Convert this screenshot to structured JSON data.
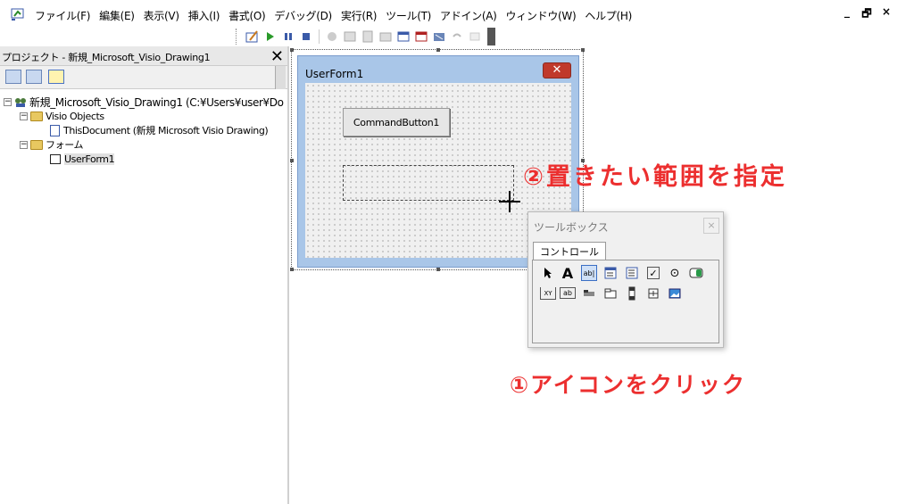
{
  "menubar": {
    "items": [
      "ファイル(F)",
      "編集(E)",
      "表示(V)",
      "挿入(I)",
      "書式(O)",
      "デバッグ(D)",
      "実行(R)",
      "ツール(T)",
      "アドイン(A)",
      "ウィンドウ(W)",
      "ヘルプ(H)"
    ],
    "window_controls": [
      "_",
      "🗗",
      "×"
    ]
  },
  "project": {
    "title": "プロジェクト - 新規_Microsoft_Visio_Drawing1",
    "close": "✕",
    "tree": {
      "root": "新規_Microsoft_Visio_Drawing1 (C:¥Users¥user¥Do",
      "visio_objects": "Visio Objects",
      "this_document": "ThisDocument (新規 Microsoft Visio Drawing)",
      "forms": "フォーム",
      "userform": "UserForm1"
    }
  },
  "form": {
    "title": "UserForm1",
    "close": "✕",
    "command_button": "CommandButton1"
  },
  "toolbox": {
    "title": "ツールボックス",
    "close": "×",
    "tab": "コントロール",
    "row1": [
      "pointer",
      "label",
      "textbox",
      "combobox",
      "listbox",
      "checkbox",
      "optionbutton",
      "togglebutton"
    ],
    "row2": [
      "frame",
      "commandbutton",
      "tabstrip",
      "multipage",
      "scrollbar",
      "spinbutton",
      "image"
    ],
    "label_glyph": "A",
    "textbox_glyph": "ab|",
    "check_glyph": "✓",
    "option_glyph": "⊙",
    "frame_glyph": "XY",
    "commandbutton_glyph": "ab"
  },
  "annotations": {
    "step2": "②置きたい範囲を指定",
    "step1": "①アイコンをクリック"
  },
  "colors": {
    "annotation": "#ec2f2f",
    "form_titlebar": "#a9c6e8",
    "close_button": "#c0392b"
  }
}
